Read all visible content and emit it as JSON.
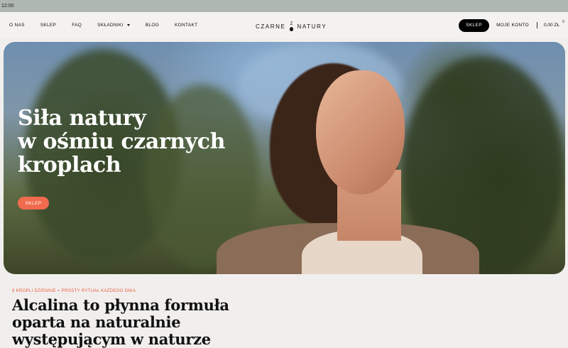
{
  "status_bar": {
    "time": "12:00"
  },
  "nav": {
    "links": [
      {
        "label": "O NAS"
      },
      {
        "label": "SKLEP"
      },
      {
        "label": "FAQ"
      },
      {
        "label": "SKŁADNIKI",
        "has_dropdown": true
      },
      {
        "label": "BLOG"
      },
      {
        "label": "KONTAKT"
      }
    ],
    "logo_left": "CZARNE",
    "logo_mark": "Z",
    "logo_right": "NATURY",
    "shop_button": "SKLEP",
    "account": "MOJE KONTO",
    "cart_total": "0,00 ZŁ",
    "cart_count": "0"
  },
  "hero": {
    "title": "Siła natury\nw ośmiu czarnych\nkroplach",
    "button": "SKLEP"
  },
  "intro": {
    "eyebrow": "8 KROPLI DZIENNIE = PROSTY RYTUAŁ KAŻDEGO DNIA",
    "headline": "Alcalina to płynna formuła oparta na naturalnie występującym w naturze"
  },
  "colors": {
    "accent": "#f06a4e",
    "eyebrow": "#e85d40",
    "dark_button": "#000000",
    "status_bar": "#aeb7b2",
    "background": "#f1efed"
  }
}
